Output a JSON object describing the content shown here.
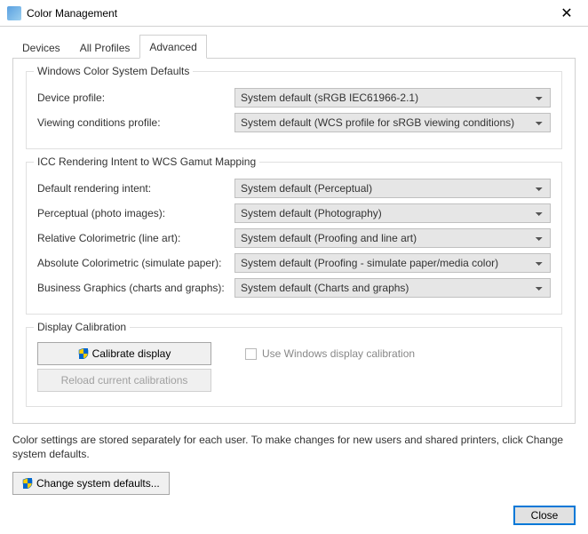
{
  "window": {
    "title": "Color Management",
    "close_glyph": "✕"
  },
  "tabs": {
    "devices": "Devices",
    "all_profiles": "All Profiles",
    "advanced": "Advanced"
  },
  "group_wcs": {
    "title": "Windows Color System Defaults",
    "device_profile_label": "Device profile:",
    "device_profile_value": "System default (sRGB IEC61966-2.1)",
    "viewing_cond_label": "Viewing conditions profile:",
    "viewing_cond_value": "System default (WCS profile for sRGB viewing conditions)"
  },
  "group_icc": {
    "title": "ICC Rendering Intent to WCS Gamut Mapping",
    "default_intent_label": "Default rendering intent:",
    "default_intent_value": "System default (Perceptual)",
    "perceptual_label": "Perceptual (photo images):",
    "perceptual_value": "System default (Photography)",
    "relative_label": "Relative Colorimetric (line art):",
    "relative_value": "System default (Proofing and line art)",
    "absolute_label": "Absolute Colorimetric (simulate paper):",
    "absolute_value": "System default (Proofing - simulate paper/media color)",
    "business_label": "Business Graphics (charts and graphs):",
    "business_value": "System default (Charts and graphs)"
  },
  "group_calib": {
    "title": "Display Calibration",
    "calibrate_btn": "Calibrate display",
    "use_windows_calib": "Use Windows display calibration",
    "reload_btn": "Reload current calibrations"
  },
  "note_text": "Color settings are stored separately for each user. To make changes for new users and shared printers, click Change system defaults.",
  "change_defaults_btn": "Change system defaults...",
  "footer": {
    "close": "Close"
  }
}
